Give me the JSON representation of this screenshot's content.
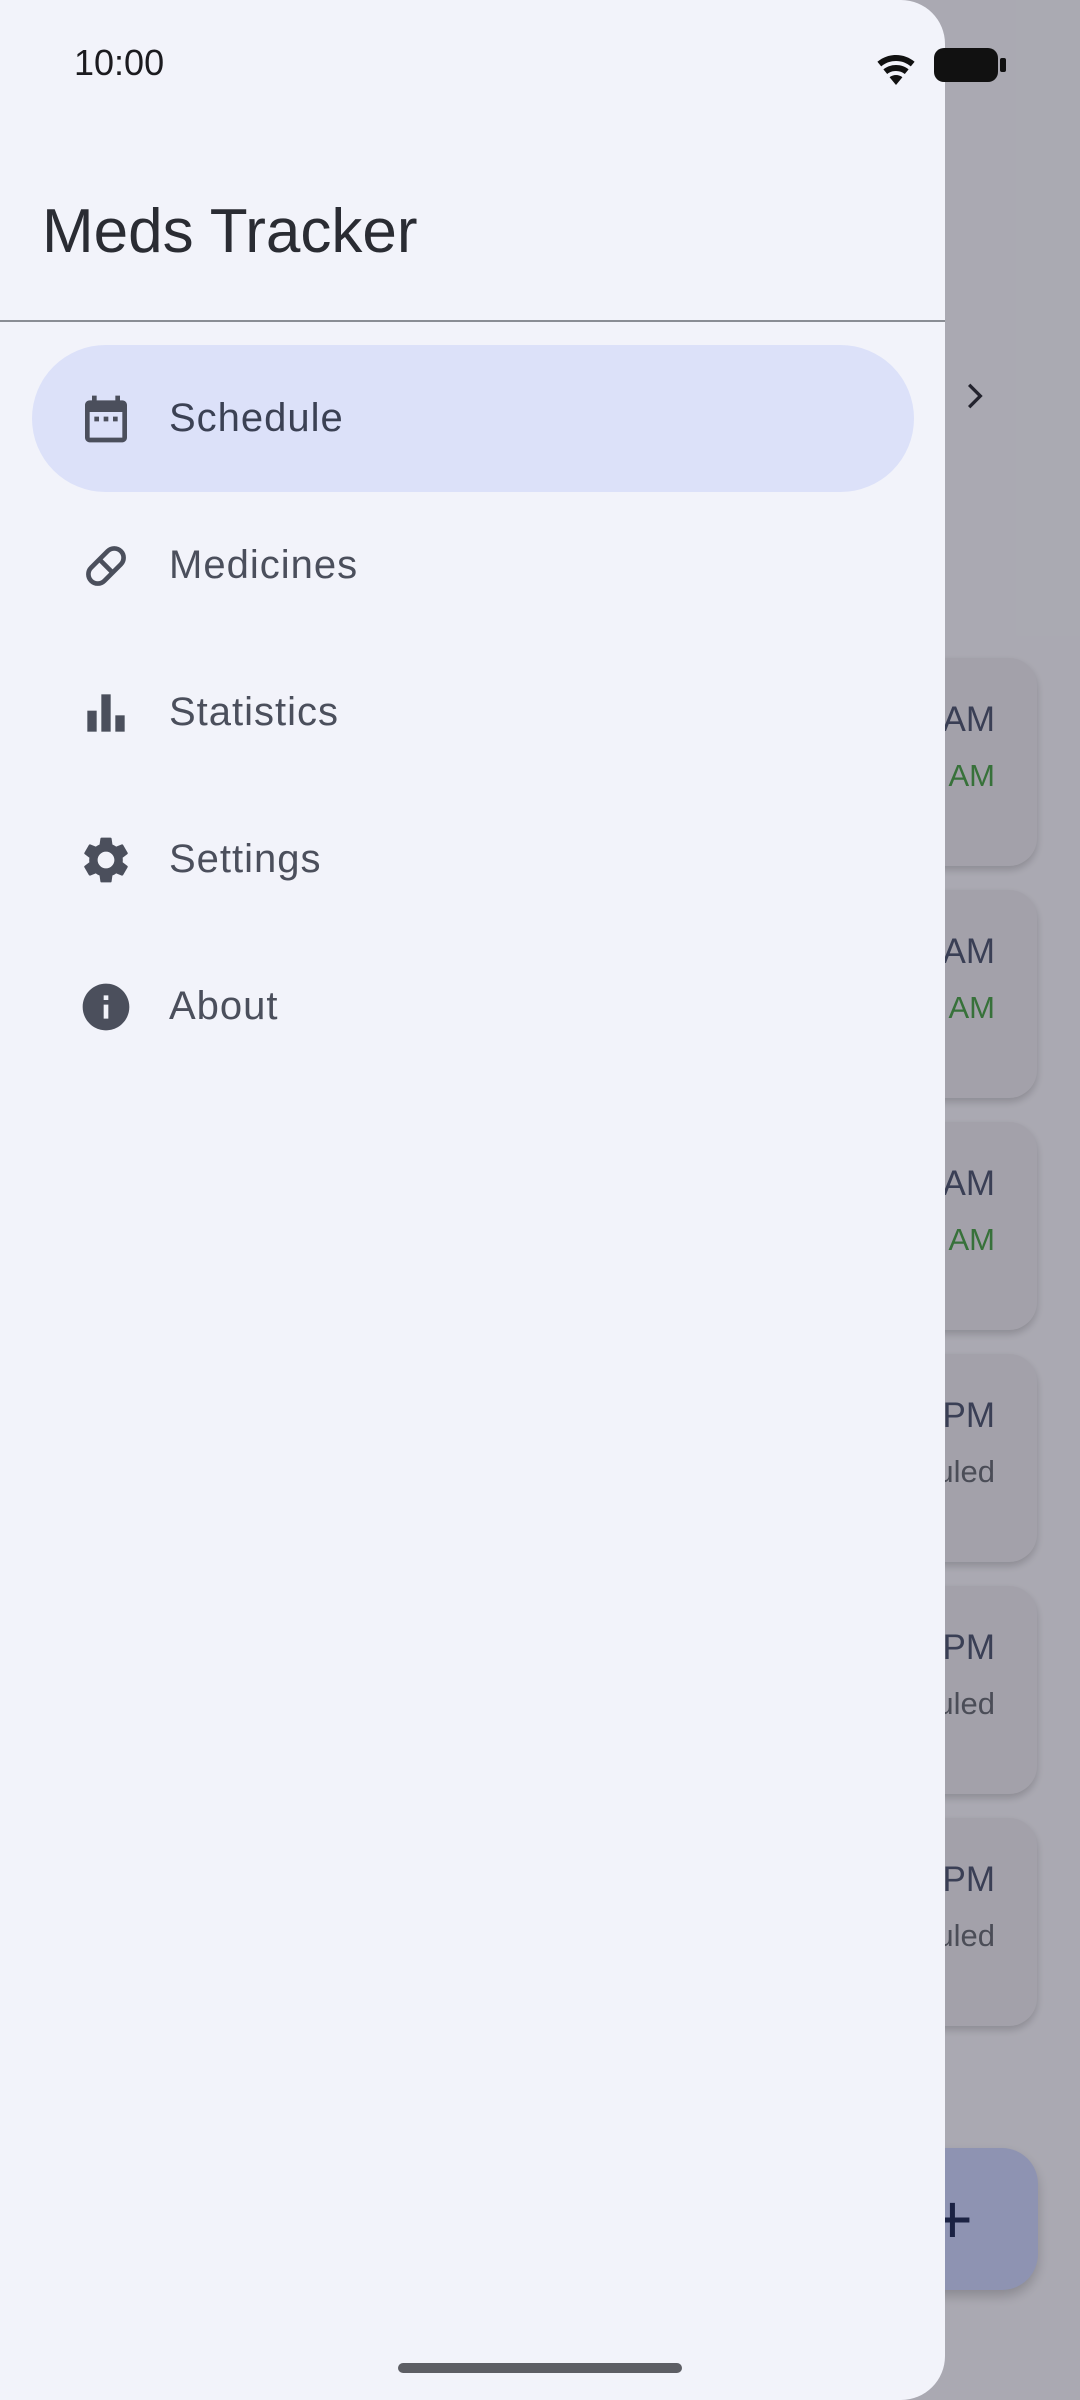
{
  "status_bar": {
    "time": "10:00",
    "wifi_icon": "wifi-icon",
    "battery_icon": "battery-icon"
  },
  "drawer": {
    "title": "Meds Tracker",
    "items": [
      {
        "label": "Schedule",
        "icon": "calendar-icon",
        "active": true
      },
      {
        "label": "Medicines",
        "icon": "pill-icon",
        "active": false
      },
      {
        "label": "Statistics",
        "icon": "bar-chart-icon",
        "active": false
      },
      {
        "label": "Settings",
        "icon": "gear-icon",
        "active": false
      },
      {
        "label": "About",
        "icon": "info-icon",
        "active": false
      }
    ]
  },
  "background_app": {
    "cards": [
      {
        "time_partial": "AM",
        "status_partial": "AM",
        "status_type": "taken"
      },
      {
        "time_partial": "AM",
        "status_partial": "AM",
        "status_type": "taken"
      },
      {
        "time_partial": "AM",
        "status_partial": "AM",
        "status_type": "taken"
      },
      {
        "time_partial": "PM",
        "status_partial": "uled",
        "status_type": "scheduled"
      },
      {
        "time_partial": "PM",
        "status_partial": "uled",
        "status_type": "scheduled"
      },
      {
        "time_partial": "PM",
        "status_partial": "uled",
        "status_type": "scheduled"
      }
    ],
    "fab_label": "+",
    "next_icon": "chevron-right-icon"
  },
  "colors": {
    "drawer_bg": "#f2f3fa",
    "active_item_bg": "#dce1f9",
    "taken_status": "#48a048",
    "scheduled_status": "#666a74"
  }
}
